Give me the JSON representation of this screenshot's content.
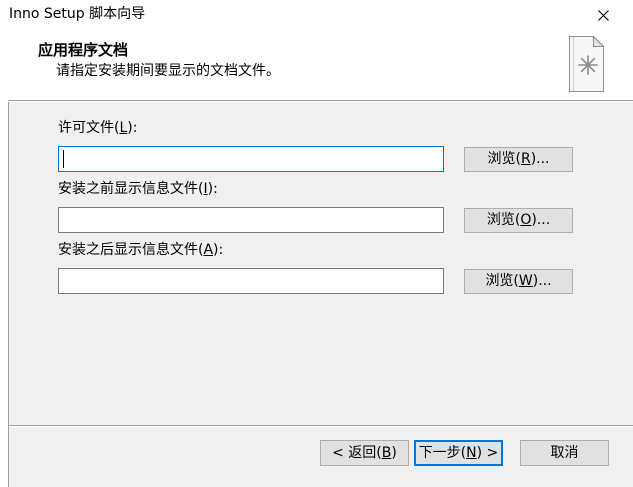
{
  "window": {
    "title": "Inno Setup 脚本向导",
    "close_icon": "close-icon"
  },
  "header": {
    "title": "应用程序文档",
    "subtitle": "请指定安装期间要显示的文档文件。",
    "icon": "document-icon"
  },
  "fields": [
    {
      "label": "许可文件(L):",
      "value": "",
      "focused": true,
      "browse_label": "浏览(R)..."
    },
    {
      "label": "安装之前显示信息文件(I):",
      "value": "",
      "focused": false,
      "browse_label": "浏览(O)..."
    },
    {
      "label": "安装之后显示信息文件(A):",
      "value": "",
      "focused": false,
      "browse_label": "浏览(W)..."
    }
  ],
  "footer": {
    "back_label": "< 返回(B)",
    "next_label": "下一步(N) >",
    "cancel_label": "取消"
  },
  "colors": {
    "accent": "#0078d7",
    "header_bg": "#ffffff",
    "body_bg": "#f0f0f0",
    "button_bg": "#e1e1e1"
  }
}
